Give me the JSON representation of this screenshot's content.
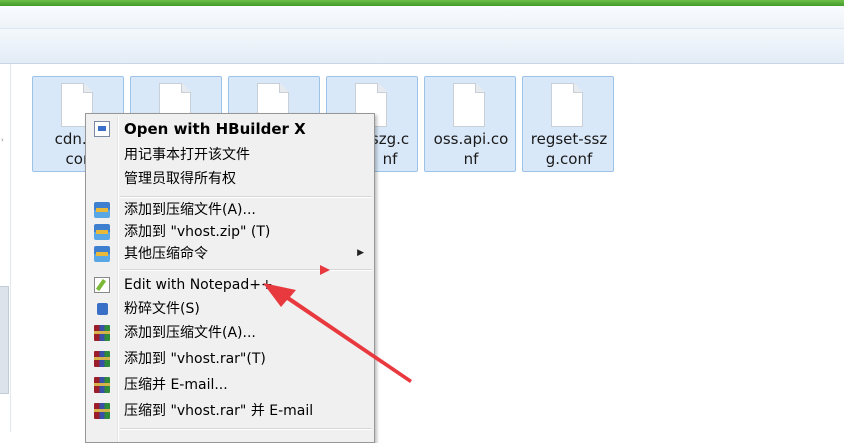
{
  "files": [
    {
      "name": "cdn.sy\ncon",
      "selected": true
    },
    {
      "name": "",
      "selected": true
    },
    {
      "name": "",
      "selected": true
    },
    {
      "name": "szg.c\nnf",
      "selected": true
    },
    {
      "name": "oss.api.co\nnf",
      "selected": true
    },
    {
      "name": "regset-ssz\ng.conf",
      "selected": true
    }
  ],
  "context_menu": {
    "items": [
      {
        "label": "Open with HBuilder X",
        "icon": "hbuilder-icon",
        "bold": true
      },
      {
        "label": "用记事本打开该文件",
        "icon": "none"
      },
      {
        "label": "管理员取得所有权",
        "icon": "none"
      },
      {
        "label": "添加到压缩文件(A)...",
        "icon": "archive-icon"
      },
      {
        "label": "添加到 \"vhost.zip\" (T)",
        "icon": "archive-icon"
      },
      {
        "label": "其他压缩命令",
        "icon": "archive-icon",
        "submenu": true
      },
      {
        "label": "Edit with Notepad++",
        "icon": "notepad-plus-icon"
      },
      {
        "label": "粉碎文件(S)",
        "icon": "shred-icon"
      },
      {
        "label": "添加到压缩文件(A)...",
        "icon": "winrar-icon"
      },
      {
        "label": "添加到 \"vhost.rar\"(T)",
        "icon": "winrar-icon"
      },
      {
        "label": "压缩并 E-mail...",
        "icon": "winrar-icon"
      },
      {
        "label": "压缩到 \"vhost.rar\" 并 E-mail",
        "icon": "winrar-icon"
      }
    ]
  },
  "annotation": {
    "color": "#e8393f",
    "points_to": "Edit with Notepad++"
  }
}
